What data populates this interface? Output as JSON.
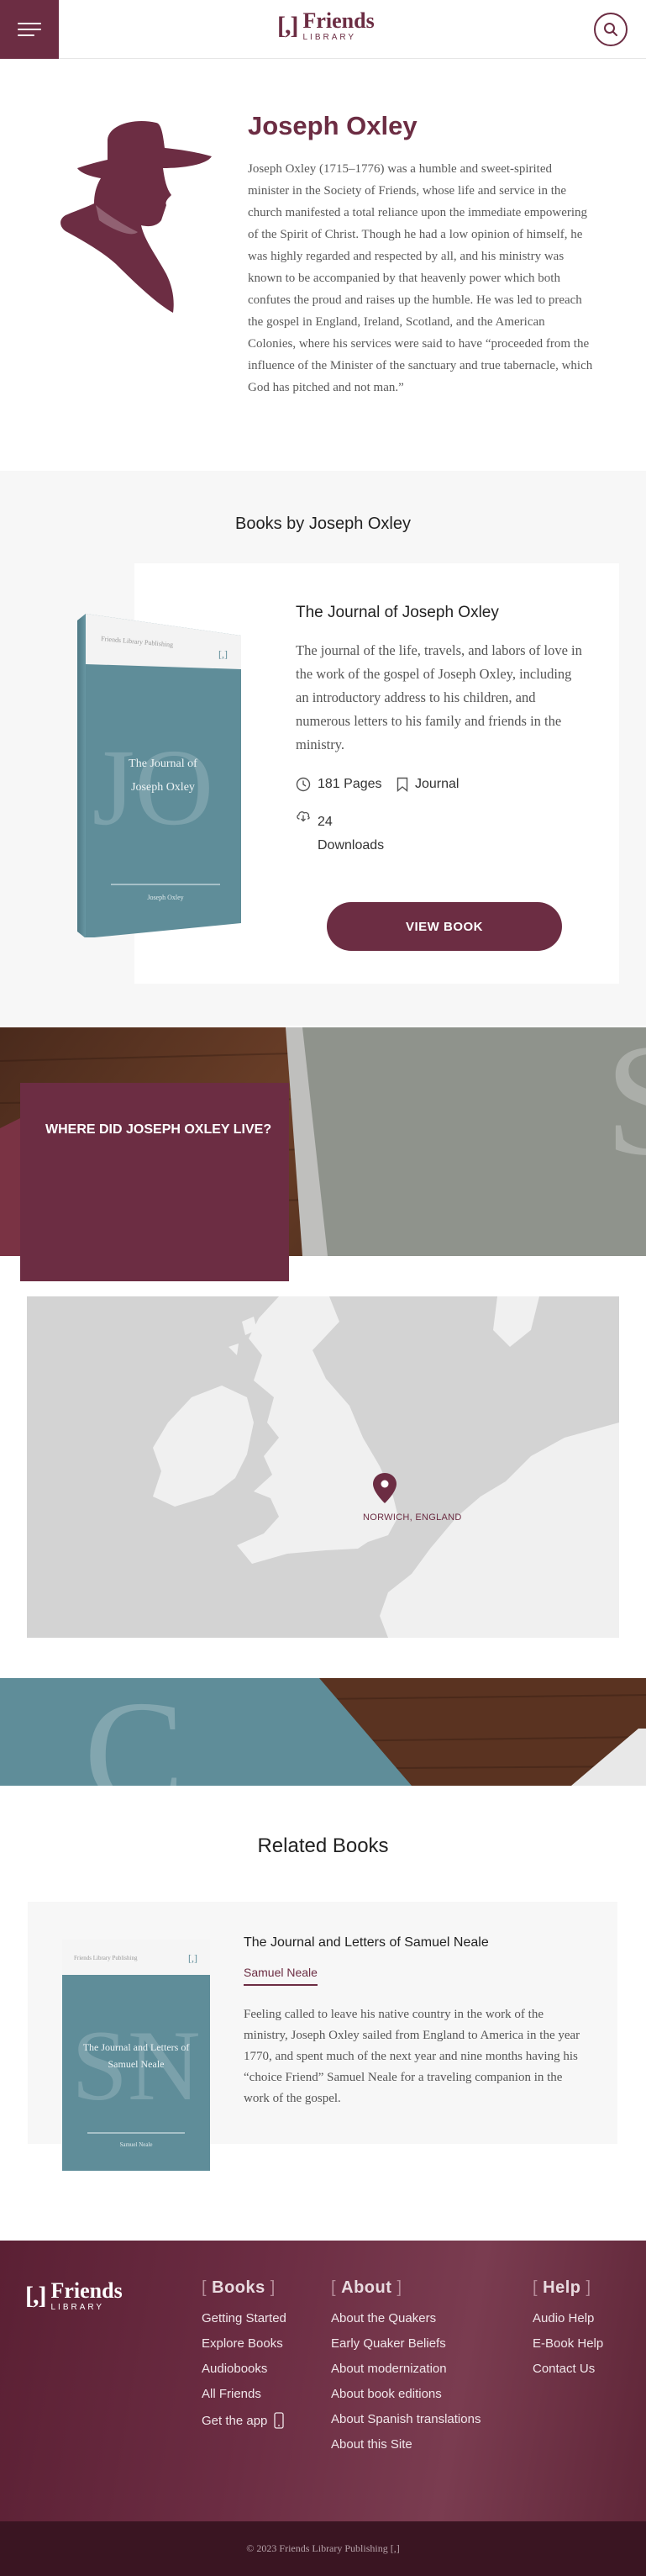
{
  "header": {
    "logo_mark": "[,]",
    "logo_name": "Friends",
    "logo_sub": "LIBRARY"
  },
  "author": {
    "name": "Joseph Oxley",
    "bio": "Joseph Oxley (1715–1776) was a humble and sweet-spirited minister in the Society of Friends, whose life and service in the church manifested a total reliance upon the immediate empowering of the Spirit of Christ. Though he had a low opinion of himself, he was highly regarded and respected by all, and his ministry was known to be accompanied by that heavenly power which both confutes the proud and raises up the humble. He was led to preach the gospel in England, Ireland, Scotland, and the American Colonies, where his services were said to have “proceeded from the influence of the Minister of the sanctuary and true tabernacle, which God has pitched and not man.”"
  },
  "books_section": {
    "title": "Books by Joseph Oxley",
    "book": {
      "title": "The Journal of Joseph Oxley",
      "cover_publisher": "Friends Library Publishing",
      "cover_title_line1": "The Journal of",
      "cover_title_line2": "Joseph Oxley",
      "cover_author": "Joseph Oxley",
      "cover_initials": "JO",
      "description": "The journal of the life, travels, and labors of love in the work of the gospel of Joseph Oxley, including an introductory address to his children, and numerous letters to his family and friends in the ministry.",
      "pages": "181 Pages",
      "type": "Journal",
      "downloads_count": "24",
      "downloads_label": "Downloads",
      "button": "VIEW BOOK"
    }
  },
  "location": {
    "heading": "WHERE DID JOSEPH OXLEY LIVE?",
    "map_label": "NORWICH, ENGLAND"
  },
  "related": {
    "title": "Related Books",
    "book": {
      "title": "The Journal and Letters of Samuel Neale",
      "author": "Samuel Neale",
      "cover_publisher": "Friends Library Publishing",
      "cover_title": "The Journal and Letters of Samuel Neale",
      "cover_initials": "SN",
      "cover_author": "Samuel Neale",
      "description": "Feeling called to leave his native country in the work of the ministry, Joseph Oxley sailed from England to America in the year 1770, and spent much of the next year and nine months having his “choice Friend” Samuel Neale for a traveling companion in the work of the gospel."
    }
  },
  "footer": {
    "logo_mark": "[,]",
    "logo_name": "Friends",
    "logo_sub": "LIBRARY",
    "books_heading": "Books",
    "books_links": [
      "Getting Started",
      "Explore Books",
      "Audiobooks",
      "All Friends",
      "Get the app"
    ],
    "about_heading": "About",
    "about_links": [
      "About the Quakers",
      "Early Quaker Beliefs",
      "About modernization",
      "About book editions",
      "About Spanish translations",
      "About this Site"
    ],
    "help_heading": "Help",
    "help_links": [
      "Audio Help",
      "E-Book Help",
      "Contact Us"
    ],
    "copyright": "© 2023 Friends Library Publishing [,]"
  },
  "colors": {
    "brand": "#6c2d43",
    "cover_teal": "#5f8d99"
  },
  "icons": [
    "menu-icon",
    "search-icon",
    "clock-icon",
    "bookmark-icon",
    "cloud-download-icon",
    "map-pin-icon",
    "phone-icon"
  ]
}
